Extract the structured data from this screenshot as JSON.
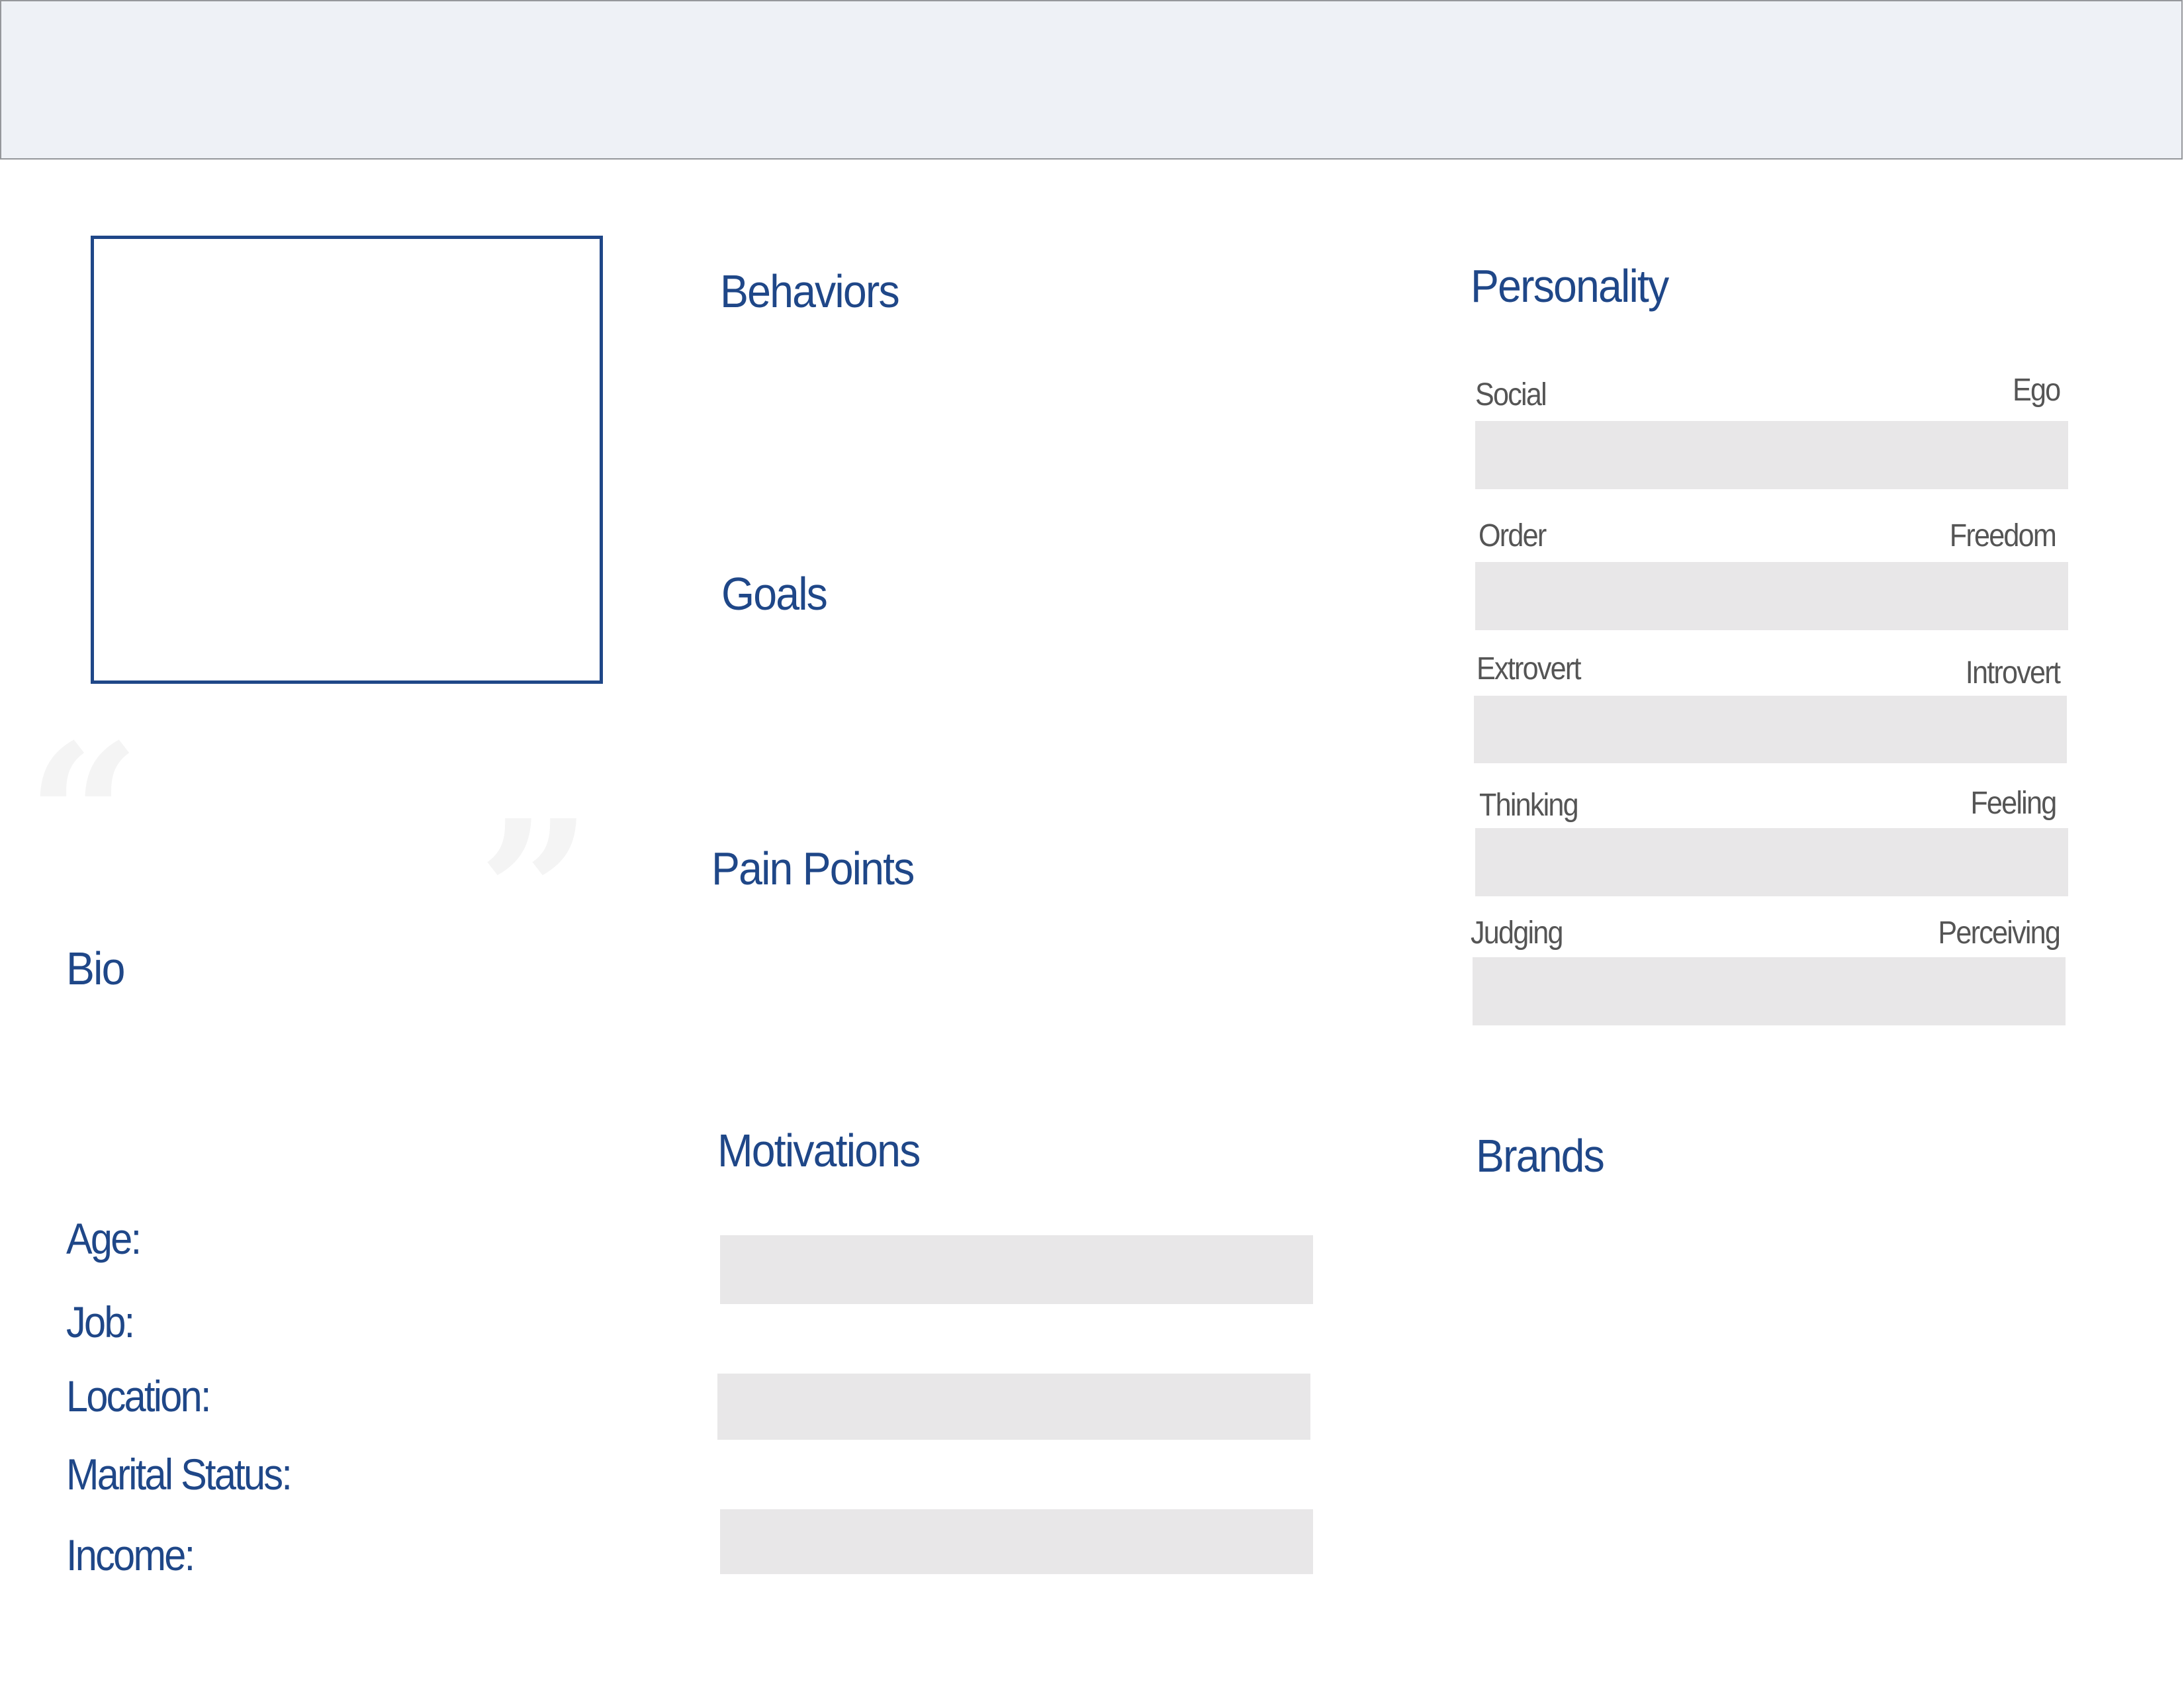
{
  "colors": {
    "accent": "#1F4788",
    "header_band": "#EEF1F6",
    "bar_fill": "#E8E7E8",
    "trait_text": "#555555",
    "quote_mark": "#F4F4F4"
  },
  "profile": {
    "photo_placeholder": "photo-frame",
    "quote_open": "“",
    "quote_close": "”",
    "bio_heading": "Bio",
    "fields": [
      {
        "label": "Age:"
      },
      {
        "label": "Job:"
      },
      {
        "label": "Location:"
      },
      {
        "label": "Marital Status:"
      },
      {
        "label": "Income:"
      }
    ]
  },
  "middle": {
    "behaviors_heading": "Behaviors",
    "goals_heading": "Goals",
    "pain_points_heading": "Pain Points",
    "motivations_heading": "Motivations",
    "motivation_bars": 3
  },
  "personality": {
    "heading": "Personality",
    "traits": [
      {
        "left": "Social",
        "right": "Ego"
      },
      {
        "left": "Order",
        "right": "Freedom"
      },
      {
        "left": "Extrovert",
        "right": "Introvert"
      },
      {
        "left": "Thinking",
        "right": "Feeling"
      },
      {
        "left": "Judging",
        "right": "Perceiving"
      }
    ]
  },
  "brands": {
    "heading": "Brands"
  }
}
